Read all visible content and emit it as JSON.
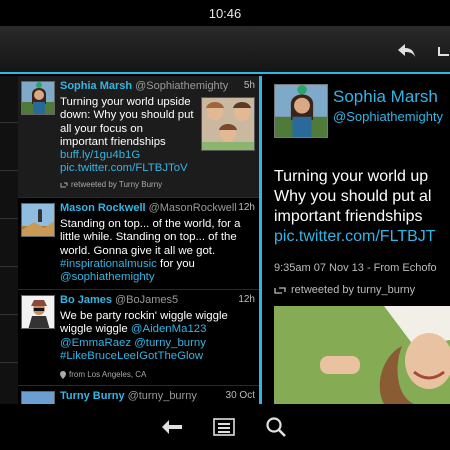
{
  "status_bar": {
    "time": "10:46"
  },
  "action_bar": {
    "reply_icon": "reply-icon",
    "retweet_icon": "retweet-icon"
  },
  "timeline": {
    "tweets": [
      {
        "name": "Sophia Marsh",
        "handle": "@Sophiathemighty",
        "time": "5h",
        "text": "Turning your world upside down: Why you should put all your focus on important friendships",
        "line1": "Turning your world upside",
        "line2": "down: Why you should put",
        "line3": "all your focus on",
        "line4": "important friendships",
        "link1": "buff.ly/1gu4b1G",
        "link2": "pic.twitter.com/FLTBJToV",
        "retweeted": "retweeted by Turny Burny"
      },
      {
        "name": "Mason Rockwell",
        "handle": "@MasonRockwell",
        "time": "12h",
        "line1": "Standing on top... of the world, for a",
        "line2": "little while. Standing on top... of the",
        "line3": "world. Gonna give it all we got.",
        "line4": "#inspirationalmusic",
        "line4b": " for you",
        "line5": "@sophiathemighty"
      },
      {
        "name": "Bo James",
        "handle": "@BoJames5",
        "time": "12h",
        "line1": "We be party rockin' wiggle wiggle",
        "line2": "wiggle wiggle ",
        "line2b": "@AidenMa123",
        "line3": "@EmmaRaez @turny_burny",
        "line4": "#LikeBruceLeeIGotTheGlow",
        "location": "from Los Angeles, CA"
      },
      {
        "name": "Turny Burny",
        "handle": "@turny_burny",
        "time": "30 Oct"
      }
    ]
  },
  "detail": {
    "name": "Sophia Marsh",
    "handle": "@Sophiathemighty",
    "line1": "Turning your world up",
    "line2": "Why you should put al",
    "line3": "important friendships",
    "link": "pic.twitter.com/FLTBJT",
    "stamp": "9:35am 07 Nov 13 - From Echofo",
    "retweeted": "retweeted by turny_burny"
  },
  "colors": {
    "accent": "#33b5e5",
    "background": "#000000"
  },
  "nav_bar": {
    "back_icon": "back-icon",
    "menu_icon": "menu-icon",
    "search_icon": "search-icon"
  }
}
